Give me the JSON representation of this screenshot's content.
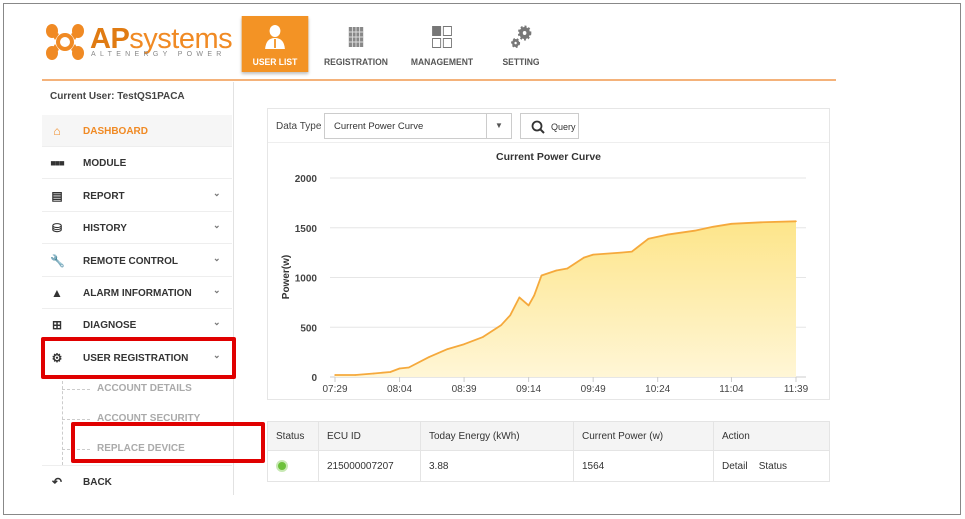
{
  "brand": {
    "name_ap": "AP",
    "name_rest": "systems",
    "tagline": "ALTENERGY POWER",
    "color": "#f08a24"
  },
  "nav": {
    "tabs": [
      {
        "label": "USER LIST",
        "icon": "user-icon",
        "active": true
      },
      {
        "label": "REGISTRATION",
        "icon": "solar-panel-icon",
        "active": false
      },
      {
        "label": "MANAGEMENT",
        "icon": "grid-icon",
        "active": false
      },
      {
        "label": "SETTING",
        "icon": "gears-icon",
        "active": false
      }
    ]
  },
  "current_user": "Current User: TestQS1PACA",
  "sidebar": {
    "items": [
      {
        "label": "DASHBOARD",
        "icon": "home-icon",
        "active": true
      },
      {
        "label": "MODULE",
        "icon": "modules-icon"
      },
      {
        "label": "REPORT",
        "icon": "report-icon",
        "expandable": true
      },
      {
        "label": "HISTORY",
        "icon": "database-icon",
        "expandable": true
      },
      {
        "label": "REMOTE CONTROL",
        "icon": "wrench-icon",
        "expandable": true
      },
      {
        "label": "ALARM INFORMATION",
        "icon": "warning-icon",
        "expandable": true
      },
      {
        "label": "DIAGNOSE",
        "icon": "medkit-icon",
        "expandable": true
      },
      {
        "label": "USER REGISTRATION",
        "icon": "gears-icon",
        "expandable": true,
        "highlighted": true
      },
      {
        "label": "BACK",
        "icon": "back-icon"
      }
    ],
    "subitems": [
      {
        "label": "ACCOUNT DETAILS"
      },
      {
        "label": "ACCOUNT SECURITY"
      },
      {
        "label": "REPLACE DEVICE",
        "highlighted": true
      }
    ]
  },
  "toolbar": {
    "data_type_label": "Data Type",
    "data_type_value": "Current Power Curve",
    "query_label": "Query"
  },
  "chart_data": {
    "type": "area",
    "title": "Current Power Curve",
    "xlabel": "",
    "ylabel": "Power(w)",
    "ylim": [
      0,
      2000
    ],
    "yticks": [
      0,
      500,
      1000,
      1500,
      2000
    ],
    "xticks": [
      "07:29",
      "08:04",
      "08:39",
      "09:14",
      "09:49",
      "10:24",
      "11:04",
      "11:39"
    ],
    "grid": true,
    "color": "#f5a93c",
    "fill": "#fde89a",
    "points": [
      [
        "07:29",
        20
      ],
      [
        "07:40",
        20
      ],
      [
        "07:50",
        35
      ],
      [
        "07:59",
        50
      ],
      [
        "08:04",
        85
      ],
      [
        "08:09",
        95
      ],
      [
        "08:20",
        200
      ],
      [
        "08:30",
        280
      ],
      [
        "08:39",
        330
      ],
      [
        "08:49",
        400
      ],
      [
        "08:59",
        520
      ],
      [
        "09:04",
        620
      ],
      [
        "09:09",
        800
      ],
      [
        "09:14",
        720
      ],
      [
        "09:17",
        820
      ],
      [
        "09:21",
        1020
      ],
      [
        "09:29",
        1070
      ],
      [
        "09:35",
        1090
      ],
      [
        "09:44",
        1200
      ],
      [
        "09:49",
        1230
      ],
      [
        "10:04",
        1250
      ],
      [
        "10:10",
        1260
      ],
      [
        "10:19",
        1390
      ],
      [
        "10:29",
        1430
      ],
      [
        "10:44",
        1470
      ],
      [
        "10:54",
        1510
      ],
      [
        "11:04",
        1540
      ],
      [
        "11:20",
        1555
      ],
      [
        "11:39",
        1565
      ]
    ]
  },
  "table": {
    "headers": [
      "Status",
      "ECU ID",
      "Today Energy (kWh)",
      "Current Power (w)",
      "Action"
    ],
    "rows": [
      {
        "status": "online",
        "status_color": "#6cc13a",
        "ecu_id": "215000007207",
        "today_energy": "3.88",
        "current_power": "1564",
        "actions": [
          "Detail",
          "Status"
        ]
      }
    ]
  }
}
